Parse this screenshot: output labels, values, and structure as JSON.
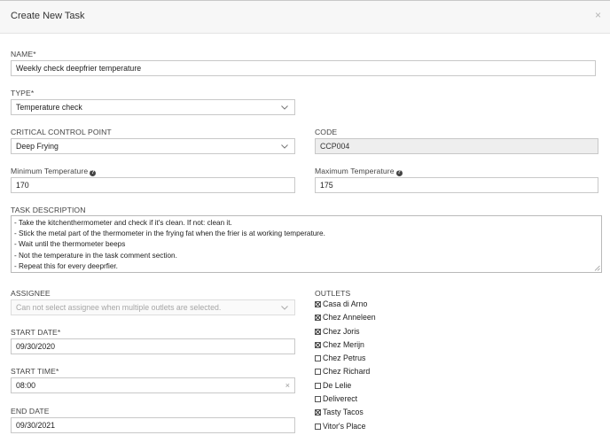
{
  "dialog": {
    "title": "Create New Task",
    "close_glyph": "×"
  },
  "form": {
    "name": {
      "label": "NAME*",
      "value": "Weekly check deepfrier temperature"
    },
    "type": {
      "label": "TYPE*",
      "value": "Temperature check"
    },
    "ccp": {
      "label": "CRITICAL CONTROL POINT",
      "value": "Deep Frying"
    },
    "code": {
      "label": "CODE",
      "value": "CCP004"
    },
    "min_temp": {
      "label": "Minimum Temperature",
      "value": "170"
    },
    "max_temp": {
      "label": "Maximum Temperature",
      "value": "175"
    },
    "description": {
      "label": "TASK DESCRIPTION",
      "lines": [
        "- Take the kitchenthermometer and check if it's clean. If not: clean it.",
        "- Stick the metal part of the thermometer in the frying fat when the frier is at working temperature.",
        "- Wait until the thermometer beeps",
        "- Not the temperature in the task comment section.",
        "- Repeat this for every deeprfier."
      ]
    },
    "assignee": {
      "label": "ASSIGNEE",
      "placeholder": "Can not select assignee when multiple outlets are selected."
    },
    "start_date": {
      "label": "START DATE*",
      "value": "09/30/2020"
    },
    "start_time": {
      "label": "START TIME*",
      "value": "08:00",
      "clear_glyph": "×"
    },
    "end_date": {
      "label": "END DATE",
      "value": "09/30/2021"
    },
    "outlets": {
      "label": "OUTLETS",
      "items": [
        {
          "name": "Casa di Arno",
          "checked": true
        },
        {
          "name": "Chez Anneleen",
          "checked": true
        },
        {
          "name": "Chez Joris",
          "checked": true
        },
        {
          "name": "Chez Merijn",
          "checked": true
        },
        {
          "name": "Chez Petrus",
          "checked": false
        },
        {
          "name": "Chez Richard",
          "checked": false
        },
        {
          "name": "De Lelie",
          "checked": false
        },
        {
          "name": "Deliverect",
          "checked": false
        },
        {
          "name": "Tasty Tacos",
          "checked": true
        },
        {
          "name": "Vitor's Place",
          "checked": false
        }
      ]
    }
  },
  "icons": {
    "info": "question-circle-icon",
    "dropdown": "chevron-down-icon",
    "clear": "close-icon"
  },
  "colors": {
    "header_bg": "#f7f7f7",
    "border": "#c8c8c8",
    "readonly_bg": "#eeeeee",
    "text": "#222222"
  }
}
